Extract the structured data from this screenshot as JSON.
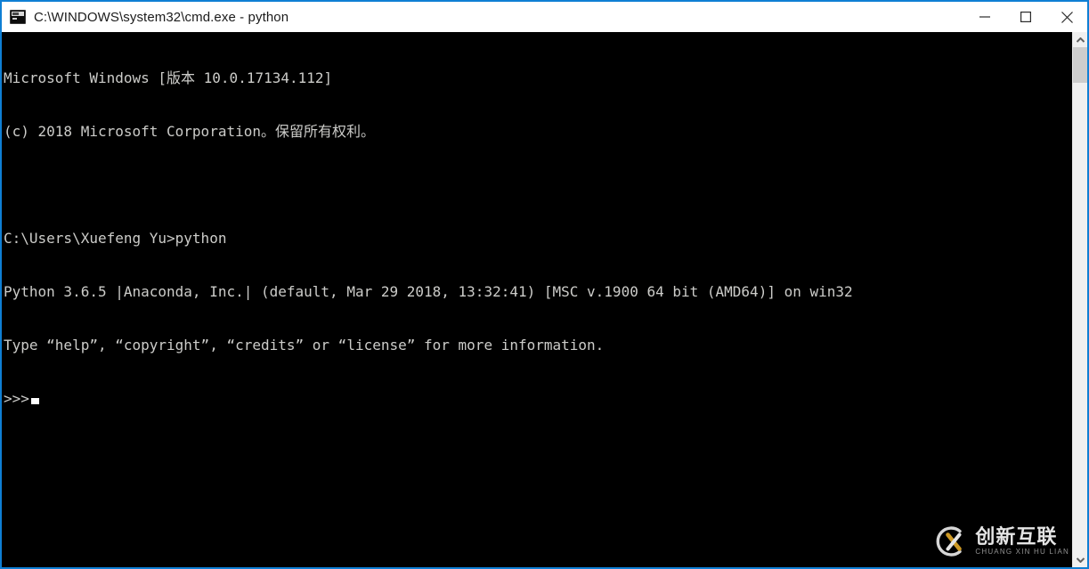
{
  "window": {
    "title": "C:\\WINDOWS\\system32\\cmd.exe - python",
    "icon": "cmd-console-icon",
    "accent_color": "#0f7fd4",
    "titlebar_bg": "#ffffff",
    "console_bg": "#000000",
    "console_fg": "#ccccc9",
    "controls": {
      "minimize_label": "Minimize",
      "maximize_label": "Maximize",
      "close_label": "Close"
    }
  },
  "console": {
    "lines": [
      "Microsoft Windows [版本 10.0.17134.112]",
      "(c) 2018 Microsoft Corporation。保留所有权利。",
      "",
      "C:\\Users\\Xuefeng Yu>python",
      "Python 3.6.5 |Anaconda, Inc.| (default, Mar 29 2018, 13:32:41) [MSC v.1900 64 bit (AMD64)] on win32",
      "Type “help”, “copyright”, “credits” or “license” for more information."
    ],
    "prompt": ">>>",
    "cursor_visible": true
  },
  "scrollbar": {
    "up_arrow": "chevron-up-icon",
    "down_arrow": "chevron-down-icon",
    "thumb_color": "#cdcdcd",
    "track_color": "#f0f0f0"
  },
  "watermark": {
    "main_text": "创新互联",
    "sub_text": "CHUANG XIN HU LIAN",
    "logo_accent": "#d9a227"
  }
}
